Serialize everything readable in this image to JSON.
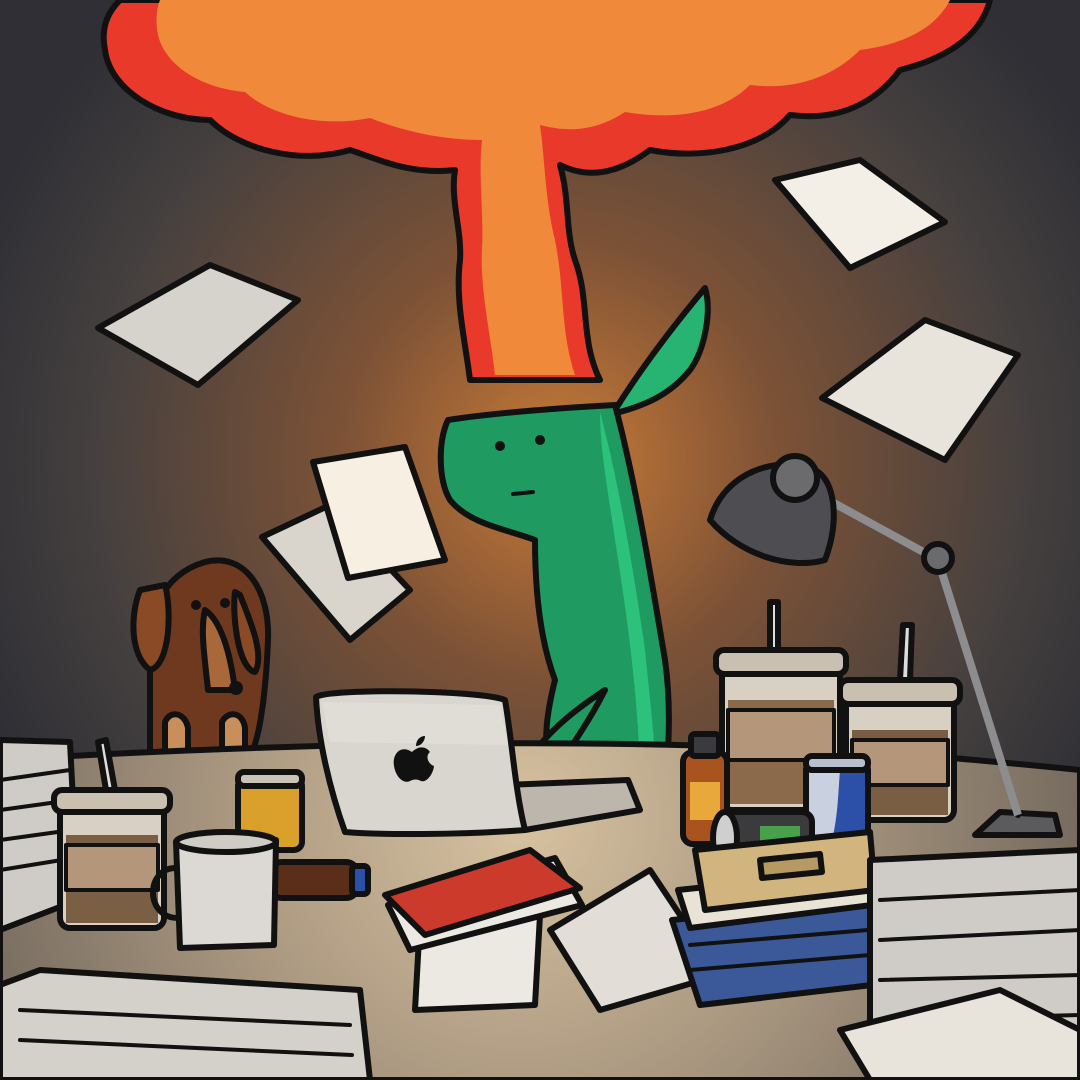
{
  "scene": {
    "description_tag": "illustration",
    "palette": {
      "wall_dark": "#38383e",
      "wall_glow": "#b06a34",
      "desk": "#b9a48b",
      "desk_shadow": "#8d7a66",
      "explosion_red": "#e8392a",
      "explosion_orange": "#f0893a",
      "character_green": "#1f9b62",
      "character_green_light": "#27b372",
      "paper": "#efece6",
      "paper_shade": "#d6d2cb",
      "laptop": "#d9d5cf",
      "book_red": "#cc3a2b",
      "book_blue": "#3b5998",
      "book_tan": "#d2b57e",
      "dog_brown": "#7a3f21",
      "lamp_gray": "#6b6b6e",
      "coffee": "#8a6a4b"
    },
    "icons": [
      "explosion-cloud-icon",
      "green-character-icon",
      "laptop-icon",
      "apple-logo-icon",
      "dog-figure-icon",
      "desk-lamp-icon",
      "coffee-cup-icon",
      "mug-icon",
      "book-stack-icon",
      "paper-sheet-icon",
      "soda-can-icon",
      "bottle-icon"
    ]
  }
}
